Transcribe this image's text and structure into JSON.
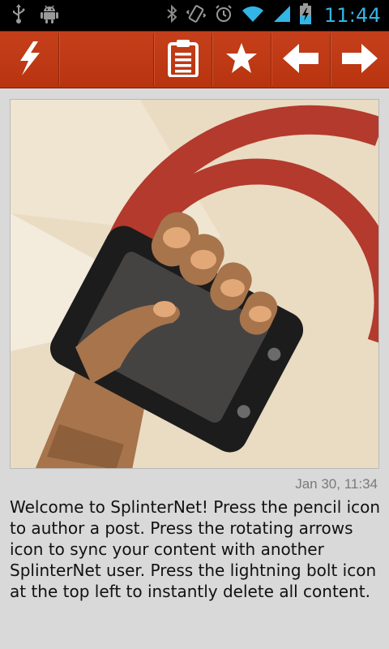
{
  "status_bar": {
    "time": "11:44",
    "left_icons": [
      "usb-icon",
      "android-debug-icon"
    ],
    "right_icons": [
      "bluetooth-icon",
      "vibrate-icon",
      "alarm-icon",
      "wifi-icon",
      "signal-icon",
      "battery-charging-icon"
    ],
    "accent_color": "#33b5e5"
  },
  "action_bar": {
    "background_color": "#bd3815",
    "buttons": [
      {
        "name": "lightning-bolt-button",
        "icon": "lightning-bolt-icon"
      },
      {
        "name": "clipboard-button",
        "icon": "clipboard-icon"
      },
      {
        "name": "star-button",
        "icon": "star-icon"
      },
      {
        "name": "back-button",
        "icon": "arrow-left-icon"
      },
      {
        "name": "forward-button",
        "icon": "arrow-right-icon"
      }
    ]
  },
  "post": {
    "image": "hand-holding-phone-illustration",
    "date": "Jan 30, 11:34",
    "body": "Welcome to SplinterNet! Press the pencil icon to author a post. Press the rotating arrows icon to sync your content with another SplinterNet user. Press the lightning bolt icon at the top left to instantly delete all content."
  }
}
